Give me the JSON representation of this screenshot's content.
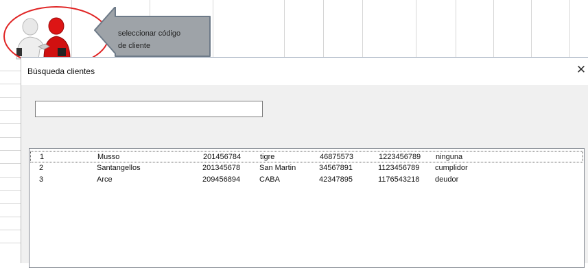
{
  "callout": {
    "text_line1": "seleccionar código",
    "text_line2": "de cliente"
  },
  "dialog": {
    "title": "Búsqueda clientes",
    "close_glyph": "✕",
    "search_value": ""
  },
  "clients": [
    {
      "id": "1",
      "name": "Musso",
      "code": "201456784",
      "city": "tigre",
      "phone": "46875573",
      "other": "1223456789",
      "status": "ninguna"
    },
    {
      "id": "2",
      "name": "Santangellos",
      "code": "201345678",
      "city": "San Martin",
      "phone": "34567891",
      "other": "1123456789",
      "status": "cumplidor"
    },
    {
      "id": "3",
      "name": "Arce",
      "code": "209456894",
      "city": "CABA",
      "phone": "42347895",
      "other": "1176543218",
      "status": "deudor"
    }
  ],
  "icon": {
    "name": "business-handshake-icon",
    "highlight_color": "#e02424",
    "accent_red": "#d01010"
  }
}
